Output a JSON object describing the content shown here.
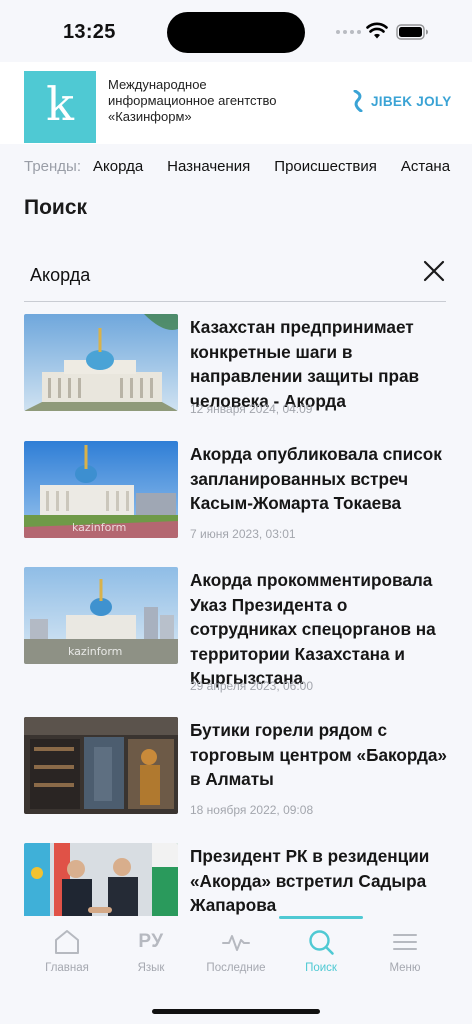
{
  "status": {
    "time": "13:25"
  },
  "header": {
    "logo_letter": "k",
    "agency_line1": "Международное",
    "agency_line2": "информационное агентство",
    "agency_line3": "«Казинформ»",
    "partner": "JIBEK JOLY"
  },
  "trends": {
    "label": "Тренды:",
    "items": [
      "Акорда",
      "Назначения",
      "Происшествия",
      "Астана"
    ]
  },
  "page_title": "Поиск",
  "search": {
    "value": "Акорда"
  },
  "results": [
    {
      "title": "Казахстан предпринимает конкретные шаги в направлении защиты прав человека - Акорда",
      "date": "12 января 2024, 04:09",
      "image": "akorda-palace-photo"
    },
    {
      "title": "Акорда опубликовала список запланированных встреч Касым-Жомарта Токаева",
      "date": "7 июня 2023, 03:01",
      "image": "akorda-palace-photo",
      "watermark": "kazinform"
    },
    {
      "title": "Акорда прокомментировала Указ Президента о сотрудниках спецорганов на территории Казахстана и Кыргызстана",
      "date": "29 апреля 2023, 06:00",
      "image": "akorda-palace-photo",
      "watermark": "kazinform"
    },
    {
      "title": "Бутики горели рядом с торговым центром «Бакорда» в Алматы",
      "date": "18 ноября 2022, 09:08",
      "image": "fire-photo"
    },
    {
      "title": "Президент РК в резиденции «Акорда» встретил Садыра Жапарова",
      "date": "",
      "image": "presidents-handshake-photo"
    }
  ],
  "tabbar": {
    "items": [
      {
        "label": "Главная",
        "icon": "home-icon"
      },
      {
        "label": "Язык",
        "icon": "language-icon",
        "glyph": "РУ"
      },
      {
        "label": "Последние",
        "icon": "pulse-icon"
      },
      {
        "label": "Поиск",
        "icon": "search-icon",
        "active": true
      },
      {
        "label": "Меню",
        "icon": "menu-icon"
      }
    ]
  },
  "colors": {
    "accent": "#4fc9d3",
    "partner": "#3aa3d5",
    "muted": "#a3a6ad"
  }
}
